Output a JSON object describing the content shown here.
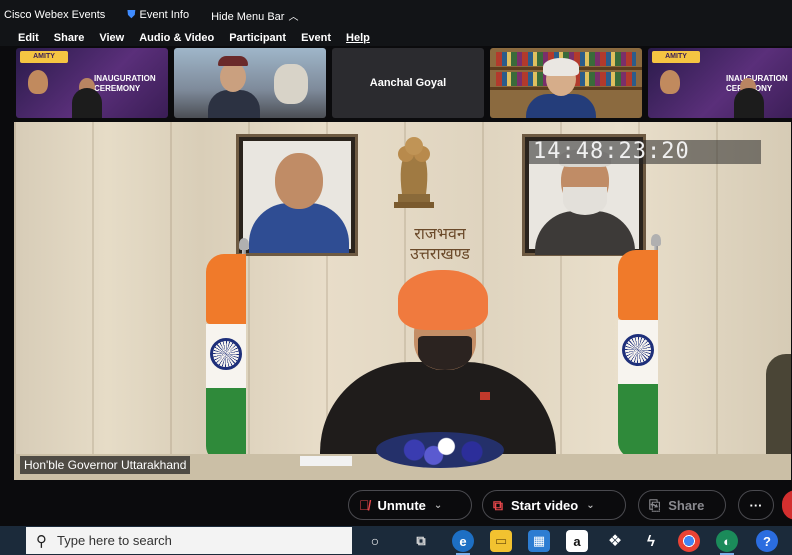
{
  "titlebar": {
    "app_name": "Cisco Webex Events",
    "event_info": "Event Info",
    "hide_menu_bar": "Hide Menu Bar",
    "hide_caret": "^"
  },
  "menubar": {
    "items": [
      "Edit",
      "Share",
      "View",
      "Audio & Video",
      "Participant",
      "Event",
      "Help"
    ]
  },
  "thumbnails": {
    "name_tile": "Aanchal Goyal",
    "poster_logo": "AMITY",
    "poster_banner_1": "INAUGURATION CEREMONY",
    "poster_banner_2": "INAUGURATION CEREMONY"
  },
  "main_video": {
    "clock": "14:48:23:20",
    "hindi_line_1": "राजभवन",
    "hindi_line_2": "उत्तराखण्ड",
    "caption": "Hon'ble Governor Uttarakhand"
  },
  "controls": {
    "unmute": "Unmute",
    "start_video": "Start video",
    "share": "Share",
    "more": "···",
    "chevron": "⌄"
  },
  "taskbar": {
    "search_placeholder": "Type here to search",
    "icons": [
      "search-o",
      "task-view",
      "edge",
      "file-explorer",
      "store",
      "amazon",
      "dropbox",
      "zap",
      "chrome",
      "webex",
      "help"
    ]
  },
  "colors": {
    "titlebar_bg": "#121417",
    "accent_red": "#e8474b",
    "taskbar_bg": "#1b2a3a",
    "shield_blue": "#3f8cff",
    "turban": "#f07a3e"
  }
}
